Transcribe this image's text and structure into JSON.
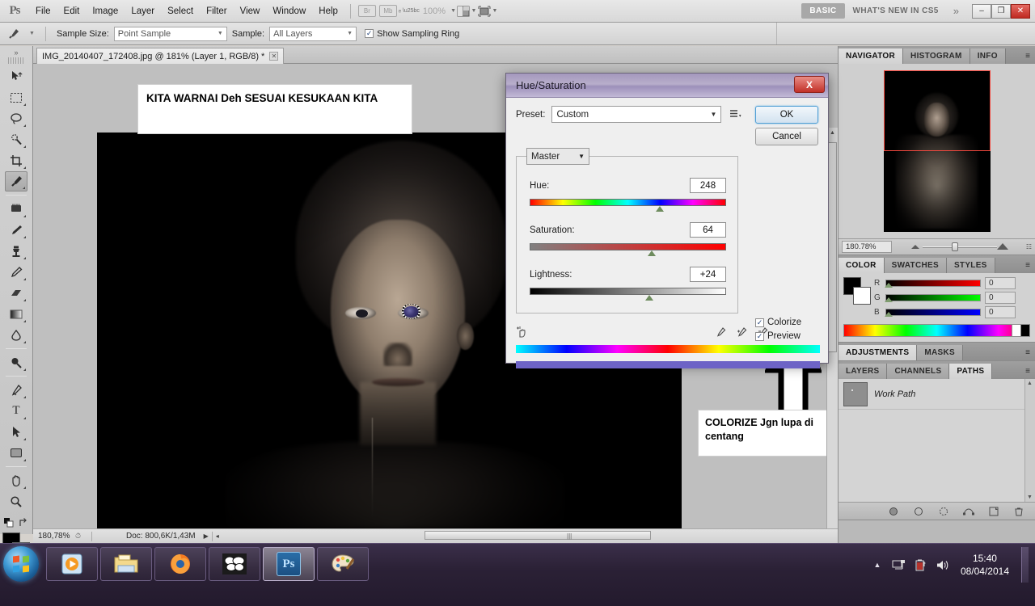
{
  "app": {
    "name": "Adobe Photoshop CS5",
    "logo": "Ps"
  },
  "menubar": {
    "items": [
      "File",
      "Edit",
      "Image",
      "Layer",
      "Select",
      "Filter",
      "View",
      "Window",
      "Help"
    ],
    "bridge_label": "Br",
    "minibridge_label": "Mb",
    "zoom_level": "100%",
    "workspace_basic": "BASIC",
    "workspace_new": "WHAT'S NEW IN CS5",
    "more_glyph": "»",
    "window_minimize": "–",
    "window_restore": "❐",
    "window_close": "✕"
  },
  "optionsbar": {
    "sample_size_label": "Sample Size:",
    "sample_size_value": "Point Sample",
    "sample_label": "Sample:",
    "sample_value": "All Layers",
    "show_ring_label": "Show Sampling Ring",
    "show_ring_checked": true,
    "check_glyph": "✓"
  },
  "toolbar": {
    "tools": [
      {
        "name": "move-tool",
        "glyph": "➤"
      },
      {
        "name": "marquee-tool",
        "glyph": "⬚"
      },
      {
        "name": "lasso-tool",
        "glyph": "◯"
      },
      {
        "name": "magic-wand-tool",
        "glyph": "❃"
      },
      {
        "name": "crop-tool",
        "glyph": "⌗"
      },
      {
        "name": "eyedropper-tool",
        "glyph": "✒"
      },
      {
        "name": "healing-brush-tool",
        "glyph": "▒"
      },
      {
        "name": "brush-tool",
        "glyph": "✐"
      },
      {
        "name": "clone-stamp-tool",
        "glyph": "⚑"
      },
      {
        "name": "history-brush-tool",
        "glyph": "✎"
      },
      {
        "name": "eraser-tool",
        "glyph": "▱"
      },
      {
        "name": "gradient-tool",
        "glyph": "▤"
      },
      {
        "name": "blur-tool",
        "glyph": "◌"
      },
      {
        "name": "dodge-tool",
        "glyph": "⚲"
      },
      {
        "name": "pen-tool",
        "glyph": "✑"
      },
      {
        "name": "type-tool",
        "glyph": "T"
      },
      {
        "name": "path-selection-tool",
        "glyph": "➤"
      },
      {
        "name": "shape-tool",
        "glyph": "▭"
      },
      {
        "name": "hand-tool",
        "glyph": "✋"
      },
      {
        "name": "zoom-tool",
        "glyph": "⚲"
      }
    ],
    "active_tool": "eyedropper-tool",
    "foreground_color": "#000000",
    "background_color": "#ffffff",
    "swap_glyph": "⇄",
    "quickmask_glyph": "▣"
  },
  "document": {
    "tab_title": "IMG_20140407_172408.jpg @ 181% (Layer 1, RGB/8) *",
    "close_glyph": "✕"
  },
  "annotations": {
    "top_note": "KITA WARNAI Deh SESUAI KESUKAAN KITA",
    "bottom_note": "COLORIZE Jgn lupa di centang"
  },
  "statusbar": {
    "zoom": "180,78%",
    "doc_info": "Doc: 800,6K/1,43M",
    "play_glyph": "▶",
    "left_glyph": "◂",
    "grip_glyph": "|||"
  },
  "dialog": {
    "title": "Hue/Saturation",
    "close_glyph": "X",
    "preset_label": "Preset:",
    "preset_value": "Custom",
    "preset_menu_glyph": "≡",
    "ok_label": "OK",
    "cancel_label": "Cancel",
    "channel_value": "Master",
    "sliders": [
      {
        "label": "Hue:",
        "value": "248",
        "percent": 68
      },
      {
        "label": "Saturation:",
        "value": "64",
        "percent": 62
      },
      {
        "label": "Lightness:",
        "value": "+24",
        "percent": 62
      }
    ],
    "colorize_label": "Colorize",
    "colorize_checked": true,
    "preview_label": "Preview",
    "preview_checked": true,
    "check_glyph": "✓",
    "scrubby_glyph": "☞",
    "eyedropper_glyph": "✒",
    "eyedropper_add_glyph": "✒",
    "eyedropper_sub_glyph": "✒"
  },
  "panels": {
    "navigator": {
      "tabs": [
        "NAVIGATOR",
        "HISTOGRAM",
        "INFO"
      ],
      "active_tab": "NAVIGATOR",
      "zoom_value": "180.78%",
      "menu_glyph": "≡"
    },
    "color": {
      "tabs": [
        "COLOR",
        "SWATCHES",
        "STYLES"
      ],
      "active_tab": "COLOR",
      "menu_glyph": "≡",
      "channels": [
        {
          "label": "R",
          "value": "0"
        },
        {
          "label": "G",
          "value": "0"
        },
        {
          "label": "B",
          "value": "0"
        }
      ]
    },
    "adjustments": {
      "tabs": [
        "ADJUSTMENTS",
        "MASKS"
      ],
      "active_tab": "ADJUSTMENTS",
      "menu_glyph": "≡"
    },
    "layers": {
      "tabs": [
        "LAYERS",
        "CHANNELS",
        "PATHS"
      ],
      "active_tab": "PATHS",
      "menu_glyph": "≡",
      "rows": [
        {
          "name": "Work Path"
        }
      ],
      "footer_icons": [
        "fill-path-icon",
        "stroke-path-icon",
        "load-selection-icon",
        "make-path-icon",
        "new-path-icon",
        "delete-path-icon"
      ],
      "scroll_up_glyph": "▲",
      "scroll_down_glyph": "▼"
    }
  },
  "taskbar": {
    "start_label": "Start",
    "buttons": [
      {
        "name": "windows-media-player",
        "glyph": "▶"
      },
      {
        "name": "windows-explorer",
        "glyph": "🗀"
      },
      {
        "name": "firefox",
        "glyph": "●"
      },
      {
        "name": "imvu",
        "glyph": "im"
      },
      {
        "name": "photoshop",
        "glyph": "Ps"
      },
      {
        "name": "paint",
        "glyph": "🎨"
      }
    ],
    "active_button": "photoshop",
    "tray": {
      "expand_glyph": "▲",
      "network_glyph": "🖧",
      "battery_glyph": "🔋",
      "volume_glyph": "🔊"
    },
    "time": "15:40",
    "date": "08/04/2014"
  }
}
